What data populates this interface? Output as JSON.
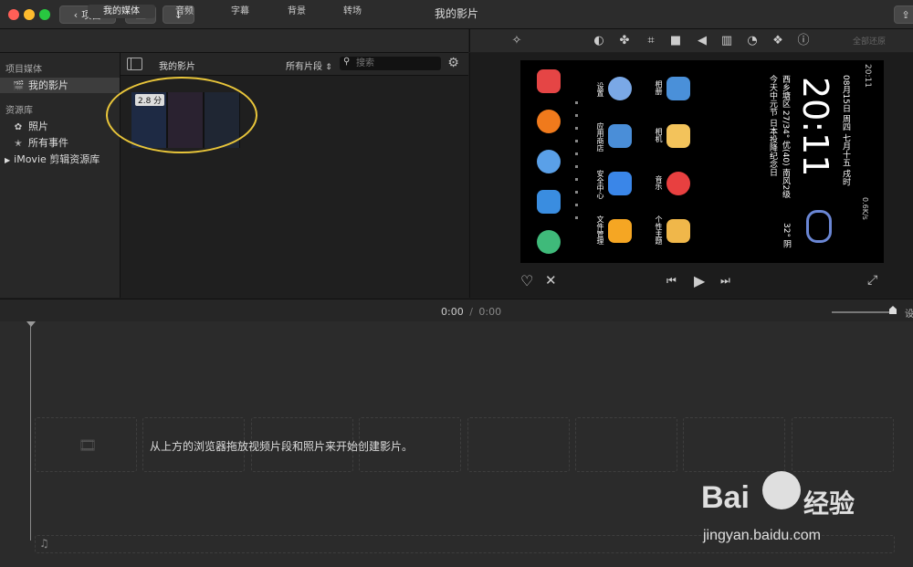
{
  "window": {
    "title": "我的影片"
  },
  "toolbar": {
    "back_label": "项目",
    "import_icon": "down-arrow-icon",
    "media_icon": "film-music-icon",
    "share_icon": "share-icon"
  },
  "tabs": [
    {
      "label": "我的媒体",
      "active": true
    },
    {
      "label": "音频",
      "active": false
    },
    {
      "label": "字幕",
      "active": false
    },
    {
      "label": "背景",
      "active": false
    },
    {
      "label": "转场",
      "active": false
    }
  ],
  "sidebar": {
    "section1": "项目媒体",
    "project_item": "我的影片",
    "section2": "资源库",
    "photos": "照片",
    "all_events": "所有事件",
    "library": "iMovie 剪辑资源库"
  },
  "browser": {
    "title": "我的影片",
    "filter": "所有片段",
    "search_placeholder": "搜索",
    "clip_duration": "2.8 分",
    "highlight_color": "#e8c53a"
  },
  "viewer": {
    "reset_all": "全部还原",
    "phone": {
      "date": "08月15日 周四 七月十五 戌时",
      "weather_loc": "西乡塘区 27/34° 优(40) 南风2级",
      "holiday": "今天中元节 日本投降纪念日",
      "time": "20:11",
      "temp": "32° 阴",
      "status_right": "0.6K/s",
      "clock_small": "20:11",
      "apps": [
        {
          "label": "设置"
        },
        {
          "label": "应用商店"
        },
        {
          "label": "安全中心"
        },
        {
          "label": "文件管理"
        },
        {
          "label": "相册"
        },
        {
          "label": "相机"
        },
        {
          "label": "音乐"
        },
        {
          "label": "个性主题"
        }
      ]
    }
  },
  "timeline": {
    "time_current": "0:00",
    "separator": "/",
    "time_total": "0:00",
    "settings_label": "设",
    "empty_hint": "从上方的浏览器拖放视频片段和照片来开始创建影片。"
  },
  "watermark": {
    "brand": "Bai",
    "brand2": "经验",
    "url": "jingyan.baidu.com"
  },
  "colors": {
    "accent_yellow": "#e8c53a",
    "light_red": "#ff5f57",
    "light_yellow": "#febc2e",
    "light_green": "#28c840"
  }
}
